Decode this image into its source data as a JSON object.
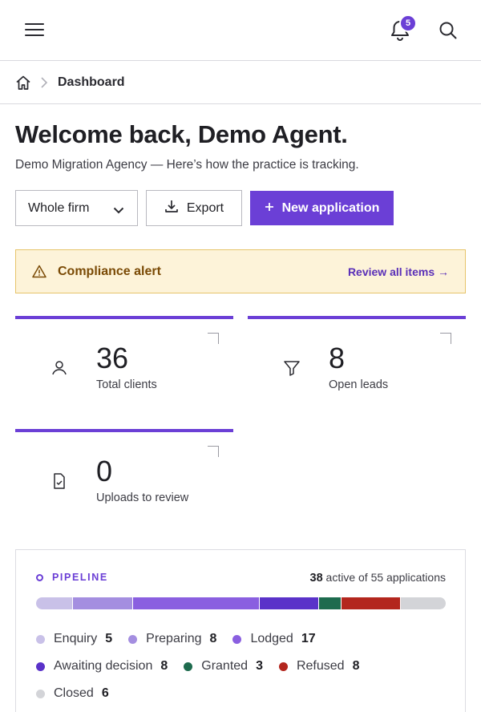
{
  "header": {
    "menu_icon": "hamburger-menu-icon",
    "notification_icon": "bell-icon",
    "notification_count": "5",
    "search_icon": "search-icon"
  },
  "breadcrumb": {
    "home_icon": "home-icon",
    "separator_icon": "chevron-right-icon",
    "current": "Dashboard"
  },
  "welcome": {
    "title": "Welcome back, Demo Agent.",
    "subtitle": "Demo Migration Agency — Here’s how the practice is tracking."
  },
  "toolbar": {
    "scope_value": "Whole firm",
    "export_label": "Export",
    "new_application_label": "New application"
  },
  "alert": {
    "title": "Compliance alert",
    "link": "Review all items →"
  },
  "stats": [
    {
      "icon": "user-icon",
      "value": "36",
      "label": "Total clients"
    },
    {
      "icon": "filter-icon",
      "value": "8",
      "label": "Open leads"
    },
    {
      "icon": "document-check-icon",
      "value": "0",
      "label": "Uploads to review"
    }
  ],
  "pipeline": {
    "title": "PIPELINE",
    "active_count": "38",
    "summary_rest": " active of 55 applications",
    "stages": [
      {
        "name": "Enquiry",
        "count": 5,
        "color": "#c9c1e8"
      },
      {
        "name": "Preparing",
        "count": 8,
        "color": "#a48ee0"
      },
      {
        "name": "Lodged",
        "count": 17,
        "color": "#8a5fe0"
      },
      {
        "name": "Awaiting decision",
        "count": 8,
        "color": "#5a32c9"
      },
      {
        "name": "Granted",
        "count": 3,
        "color": "#1e6b4e"
      },
      {
        "name": "Refused",
        "count": 8,
        "color": "#b3261e"
      },
      {
        "name": "Closed",
        "count": 6,
        "color": "#d3d4d8"
      }
    ]
  },
  "colors": {
    "accent": "#6b3fd6",
    "alert_bg": "#fdf3d9",
    "alert_text": "#7a4a05"
  }
}
